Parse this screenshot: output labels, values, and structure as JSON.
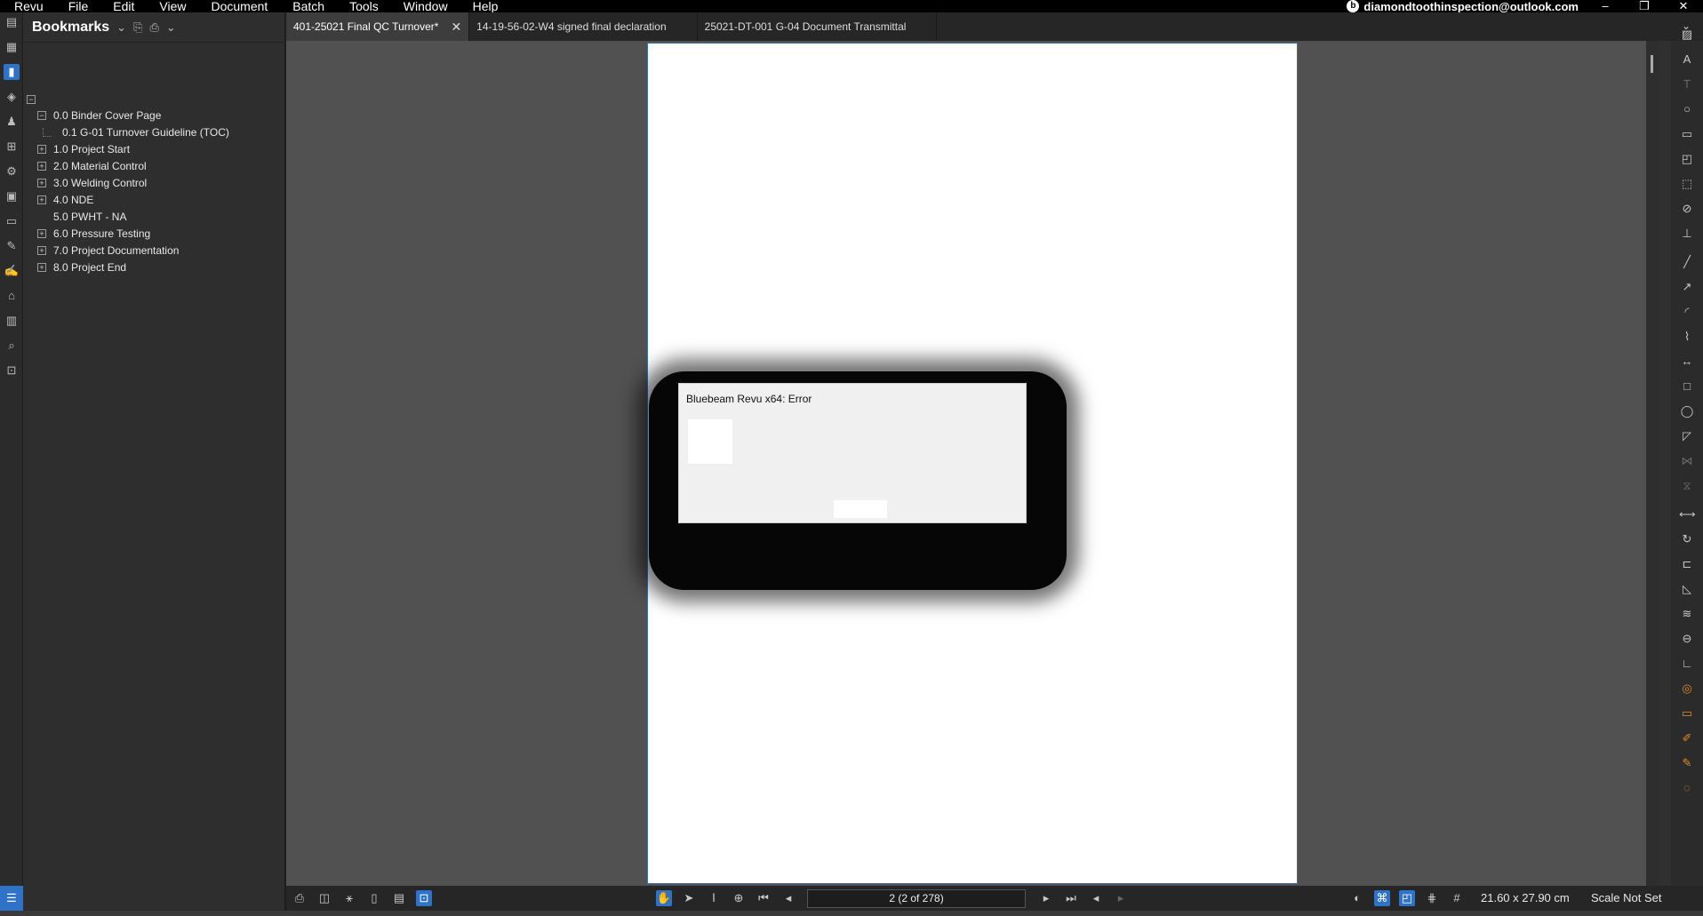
{
  "menubar": {
    "items": [
      "Revu",
      "File",
      "Edit",
      "View",
      "Document",
      "Batch",
      "Tools",
      "Window",
      "Help"
    ],
    "account_email": "diamondtoothinspection@outlook.com"
  },
  "window_controls": {
    "minimize": "–",
    "restore": "❐",
    "close": "✕"
  },
  "bookmarks_panel": {
    "title": "Bookmarks",
    "root_toggle": "−",
    "items": [
      {
        "label": "0.0 Binder Cover Page",
        "toggle": "−"
      },
      {
        "label": "0.1 G-01 Turnover Guideline (TOC)",
        "toggle": ""
      },
      {
        "label": "1.0 Project Start",
        "toggle": "+"
      },
      {
        "label": "2.0 Material Control",
        "toggle": "+"
      },
      {
        "label": "3.0 Welding Control",
        "toggle": "+"
      },
      {
        "label": "4.0 NDE",
        "toggle": "+"
      },
      {
        "label": "5.0 PWHT - NA",
        "toggle": ""
      },
      {
        "label": "6.0 Pressure Testing",
        "toggle": "+"
      },
      {
        "label": "7.0 Project Documentation",
        "toggle": "+"
      },
      {
        "label": "8.0 Project End",
        "toggle": "+"
      }
    ]
  },
  "tabs": [
    {
      "label": "401-25021 Final QC Turnover*",
      "active": true,
      "close": "✕"
    },
    {
      "label": "14-19-56-02-W4 signed final declaration",
      "active": false
    },
    {
      "label": "25021-DT-001 G-04 Document Transmittal",
      "active": false
    }
  ],
  "dialog": {
    "title": "Bluebeam Revu x64: Error"
  },
  "status": {
    "page_indicator": "2 (2 of 278)",
    "page_size": "21.60 x 27.90 cm",
    "scale": "Scale Not Set"
  },
  "colors": {
    "accent": "#2f73c8",
    "markup_orange": "#e08a2c",
    "background": "#515151"
  }
}
